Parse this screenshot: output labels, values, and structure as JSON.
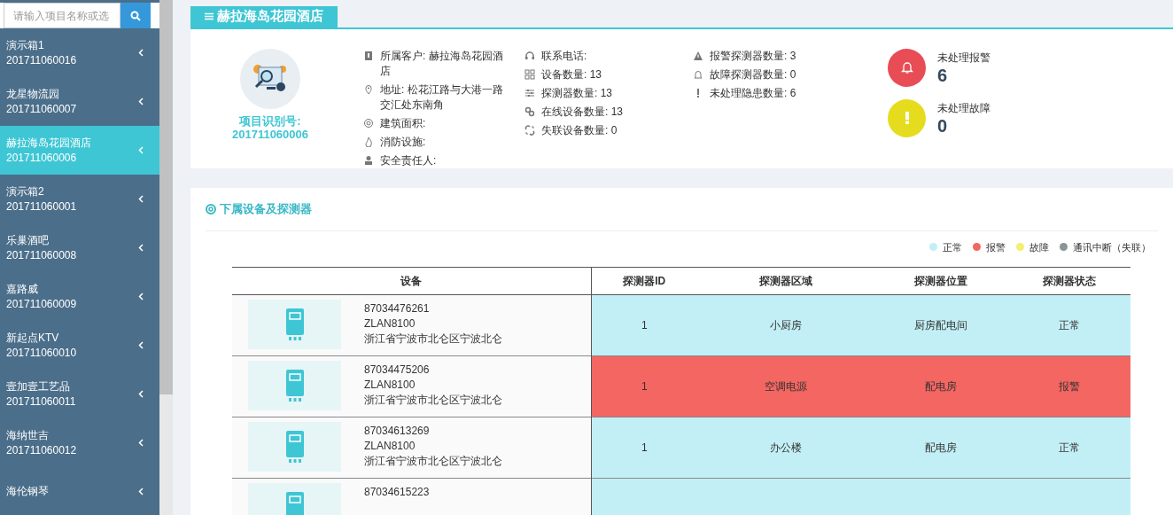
{
  "sidebar": {
    "search": {
      "placeholder": "请输入项目名称或选"
    },
    "items": [
      {
        "name": "演示箱1",
        "code": "201711060016",
        "selected": false
      },
      {
        "name": "龙星物流园",
        "code": "201711060007",
        "selected": false
      },
      {
        "name": "赫拉海岛花园酒店",
        "code": "201711060006",
        "selected": true
      },
      {
        "name": "演示箱2",
        "code": "201711060001",
        "selected": false
      },
      {
        "name": "乐巢酒吧",
        "code": "201711060008",
        "selected": false
      },
      {
        "name": "嘉路威",
        "code": "201711060009",
        "selected": false
      },
      {
        "name": "新起点KTV",
        "code": "201711060010",
        "selected": false
      },
      {
        "name": "壹加壹工艺品",
        "code": "201711060011",
        "selected": false
      },
      {
        "name": "海纳世吉",
        "code": "201711060012",
        "selected": false
      },
      {
        "name": "海伦钢琴",
        "selected": false
      }
    ]
  },
  "project": {
    "title": "赫拉海岛花园酒店",
    "id_label": "项目识别号:",
    "id": "201711060006",
    "info_columns": [
      [
        "所属客户: 赫拉海岛花园酒店",
        "地址: 松花江路与大港一路交汇处东南角",
        "建筑面积:",
        "消防设施:",
        "安全责任人:"
      ],
      [
        "联系电话:",
        "设备数量: 13",
        "探测器数量: 13",
        "在线设备数量: 13",
        "失联设备数量: 0"
      ],
      [
        "报警探测器数量: 3",
        "故障探测器数量: 0",
        "未处理隐患数量: 6"
      ]
    ],
    "summary": [
      {
        "kind": "alarm",
        "label": "未处理报警",
        "value": "6"
      },
      {
        "kind": "fault",
        "label": "未处理故障",
        "value": "0"
      }
    ]
  },
  "devices": {
    "title": "下属设备及探测器",
    "legend": [
      {
        "label": "正常",
        "color": "#c2eff5"
      },
      {
        "label": "报警",
        "color": "#f36662"
      },
      {
        "label": "故障",
        "color": "#f4ef6c"
      },
      {
        "label": "通讯中断（失联）",
        "color": "#8a9598"
      }
    ],
    "columns": [
      "设备",
      "探测器ID",
      "探测器区域",
      "探测器位置",
      "探测器状态"
    ],
    "rows": [
      {
        "device": [
          "87034476261",
          "ZLAN8100",
          "浙江省宁波市北仑区宁波北仑"
        ],
        "detector_id": "1",
        "area": "小厨房",
        "location": "厨房配电间",
        "status": "正常",
        "color": "#c2eff5"
      },
      {
        "device": [
          "87034475206",
          "ZLAN8100",
          "浙江省宁波市北仑区宁波北仑"
        ],
        "detector_id": "1",
        "area": "空调电源",
        "location": "配电房",
        "status": "报警",
        "color": "#f36662"
      },
      {
        "device": [
          "87034613269",
          "ZLAN8100",
          "浙江省宁波市北仑区宁波北仑"
        ],
        "detector_id": "1",
        "area": "办公楼",
        "location": "配电房",
        "status": "正常",
        "color": "#c2eff5"
      },
      {
        "device": [
          "87034615223"
        ],
        "color": "#c2eff5"
      }
    ]
  }
}
